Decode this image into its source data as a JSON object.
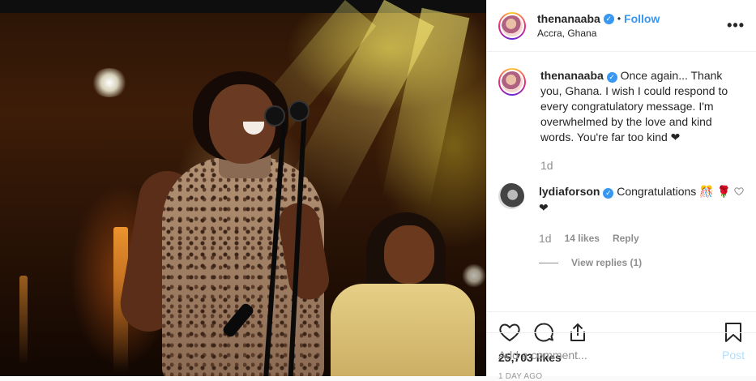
{
  "header": {
    "username": "thenanaaba",
    "separator": "•",
    "follow_label": "Follow",
    "location": "Accra, Ghana",
    "more_icon": "more-options-icon"
  },
  "caption": {
    "username": "thenanaaba",
    "text": "Once again... Thank you, Ghana. I wish I could respond to every congratulatory message. I'm overwhelmed by the love and kind words. You're far too kind ❤",
    "age": "1d"
  },
  "comment": {
    "username": "lydiaforson",
    "text": "Congratulations 🎊 🌹❤",
    "age": "1d",
    "likes": "14 likes",
    "reply_label": "Reply",
    "view_replies": "View replies (1)"
  },
  "post": {
    "likes": "25,703 likes",
    "timestamp": "1 DAY AGO"
  },
  "composer": {
    "placeholder": "Add a comment...",
    "post_label": "Post"
  },
  "colors": {
    "accent": "#3897f0",
    "text": "#262626",
    "muted": "#8e8e8e",
    "post_disabled": "#b2dffc"
  }
}
